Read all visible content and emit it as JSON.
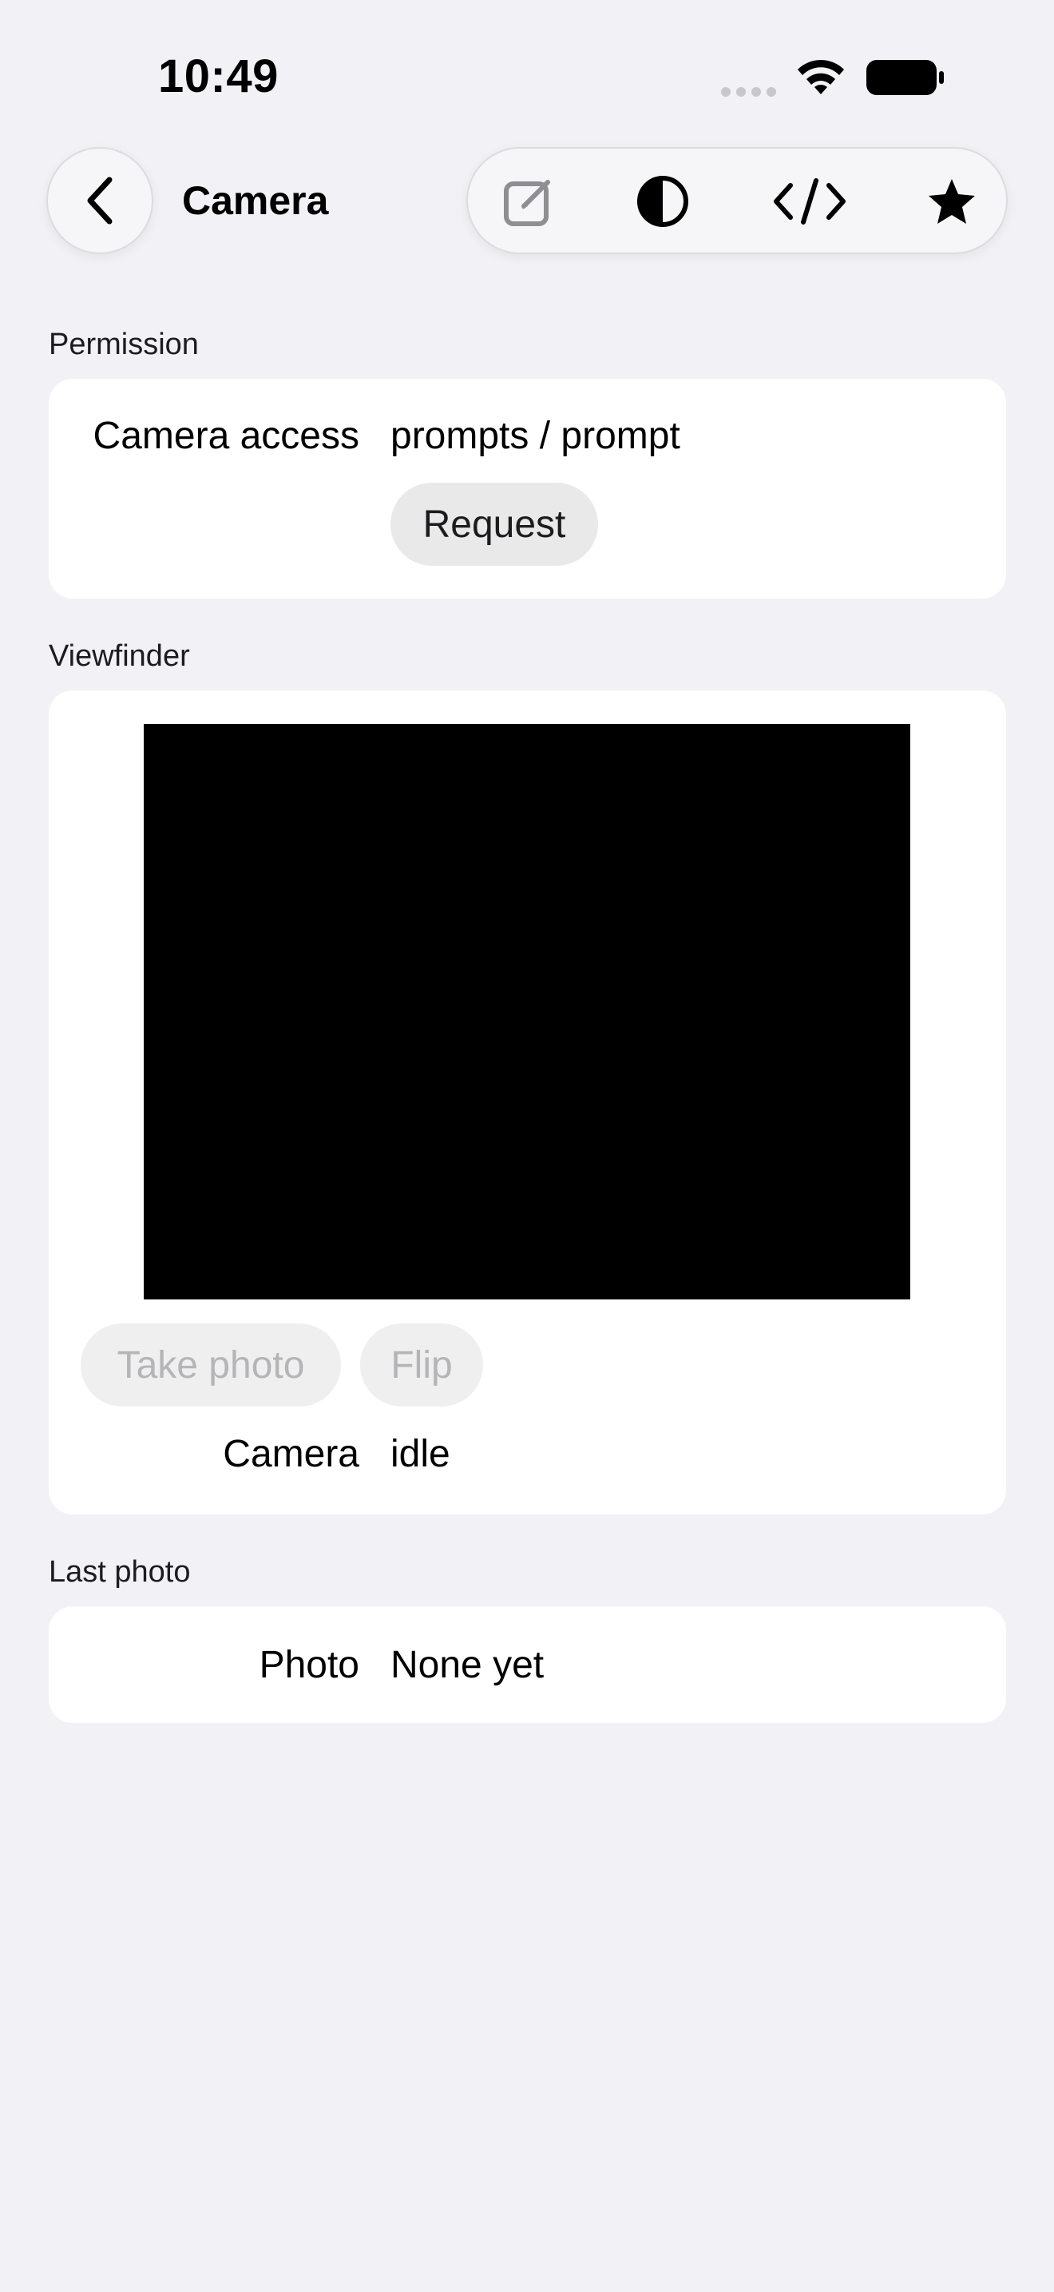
{
  "status_bar": {
    "time": "10:49"
  },
  "nav": {
    "title": "Camera",
    "back_icon": "chevron-left-icon",
    "toolbar_icons": [
      "compose-icon",
      "contrast-icon",
      "code-icon",
      "star-icon"
    ]
  },
  "permission": {
    "header": "Permission",
    "label": "Camera access",
    "value": "prompts / prompt",
    "request_button": "Request"
  },
  "viewfinder": {
    "header": "Viewfinder",
    "take_photo_button": "Take photo",
    "flip_button": "Flip",
    "status_label": "Camera",
    "status_value": "idle"
  },
  "last_photo": {
    "header": "Last photo",
    "label": "Photo",
    "value": "None yet"
  },
  "colors": {
    "background": "#f2f1f6",
    "card": "#ffffff",
    "viewfinder": "#000000",
    "disabled_text": "#b5b5b8"
  }
}
